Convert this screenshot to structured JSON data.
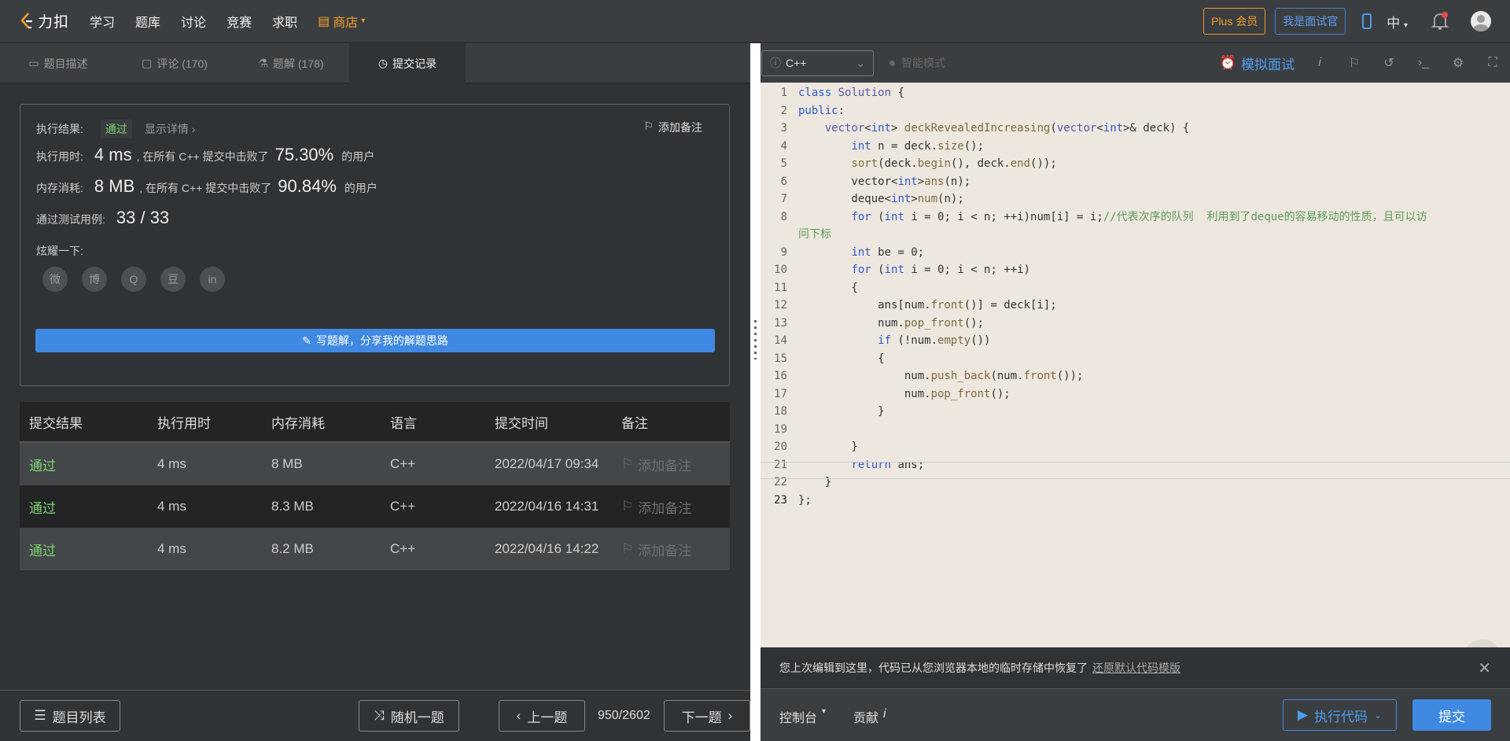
{
  "nav": {
    "logo_text": "力扣",
    "items": [
      "学习",
      "题库",
      "讨论",
      "竞赛",
      "求职"
    ],
    "store": "商店",
    "plus": "Plus 会员",
    "interviewer": "我是面试官",
    "lang": "中",
    "accent": "#f3a02a"
  },
  "tabs": [
    {
      "label": "题目描述",
      "icon": "doc-icon"
    },
    {
      "label": "评论 (170)",
      "icon": "comment-icon"
    },
    {
      "label": "题解 (178)",
      "icon": "flask-icon"
    },
    {
      "label": "提交记录",
      "icon": "clock-icon",
      "active": true
    }
  ],
  "result": {
    "status_label": "执行结果:",
    "status": "通过",
    "detail": "显示详情",
    "add_note": "添加备注",
    "time_label": "执行用时:",
    "time_value": "4 ms",
    "time_mid": ", 在所有 C++ 提交中击败了",
    "time_pct": "75.30%",
    "user_suffix": "的用户",
    "mem_label": "内存消耗:",
    "mem_value": "8 MB",
    "mem_pct": "90.84%",
    "tests_label": "通过测试用例:",
    "tests_value": "33 / 33",
    "share_label": "炫耀一下:",
    "share_icons": [
      "wechat-icon",
      "weibo-icon",
      "qq-icon",
      "douban-icon",
      "linkedin-icon"
    ],
    "share_glyphs": [
      "微",
      "博",
      "Q",
      "豆",
      "in"
    ],
    "write_btn": "写题解，分享我的解题思路"
  },
  "table": {
    "headers": [
      "提交结果",
      "执行用时",
      "内存消耗",
      "语言",
      "提交时间",
      "备注"
    ],
    "rows": [
      {
        "result": "通过",
        "time": "4 ms",
        "mem": "8 MB",
        "lang": "C++",
        "date": "2022/04/17 09:34",
        "note": "添加备注"
      },
      {
        "result": "通过",
        "time": "4 ms",
        "mem": "8.3 MB",
        "lang": "C++",
        "date": "2022/04/16 14:31",
        "note": "添加备注"
      },
      {
        "result": "通过",
        "time": "4 ms",
        "mem": "8.2 MB",
        "lang": "C++",
        "date": "2022/04/16 14:22",
        "note": "添加备注"
      }
    ]
  },
  "bottom": {
    "list": "题目列表",
    "random": "随机一题",
    "prev": "上一题",
    "page": "950/2602",
    "next": "下一题"
  },
  "editor": {
    "language": "C++",
    "smart": "智能模式",
    "mock": "模拟面试",
    "notice": "您上次编辑到这里，代码已从您浏览器本地的临时存储中恢复了",
    "restore": "还原默认代码模版",
    "console": "控制台",
    "contribute": "贡献",
    "run": "执行代码",
    "submit": "提交"
  }
}
